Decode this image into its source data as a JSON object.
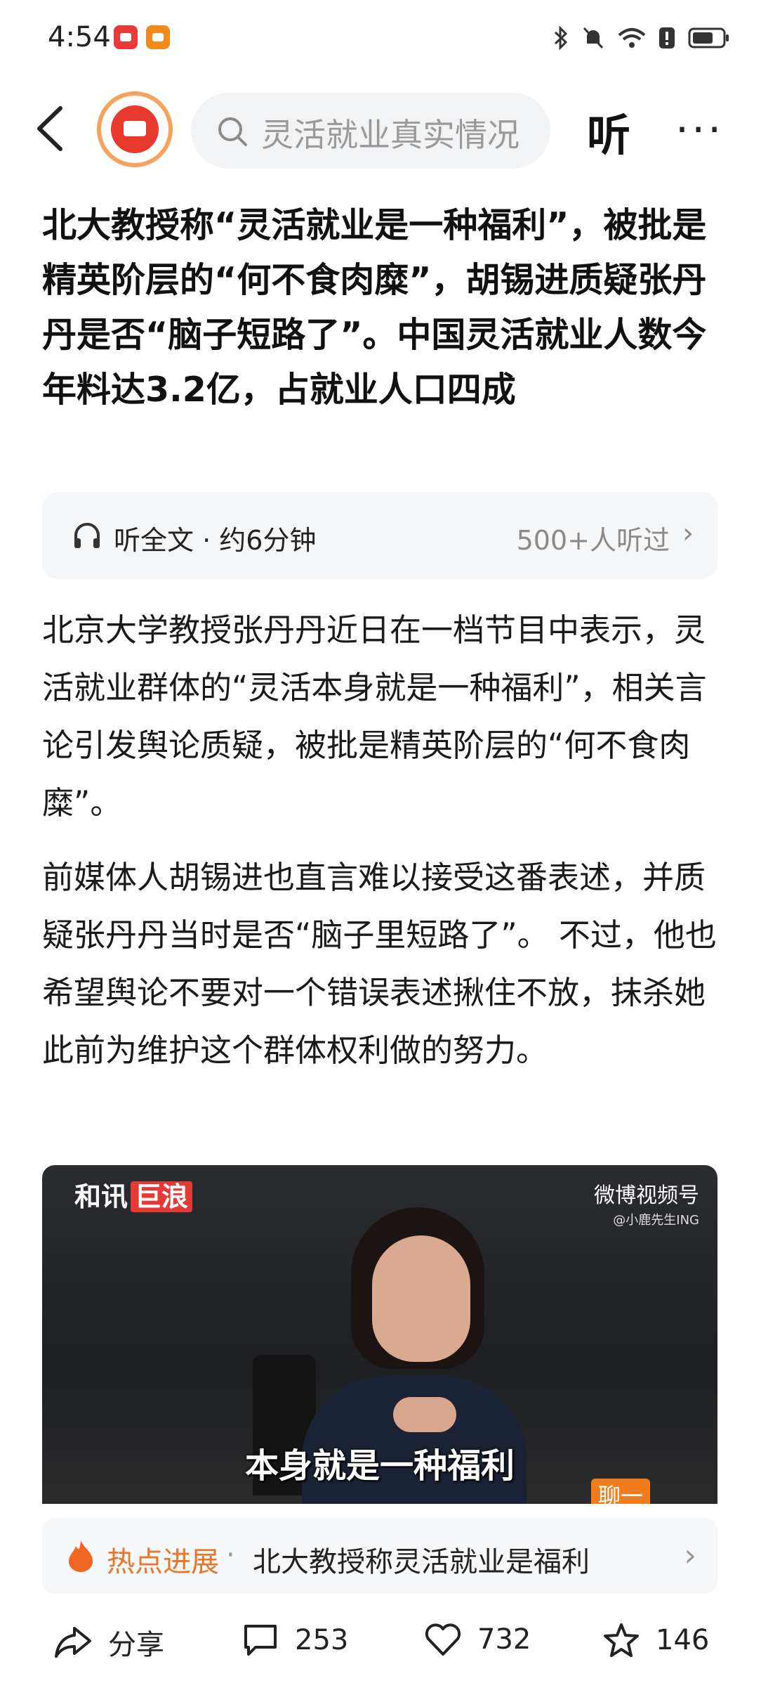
{
  "status_bar": {
    "time": "4:54"
  },
  "topbar": {
    "search_placeholder": "灵活就业真实情况",
    "listen_label": "听",
    "more_label": "···"
  },
  "article": {
    "title": "北大教授称“灵活就业是一种福利”，被批是精英阶层的“何不食肉糜”，胡锡进质疑张丹丹是否“脑子短路了”。中国灵活就业人数今年料达3.2亿，占就业人口四成",
    "audio": {
      "label": "听全文 · 约6分钟",
      "count": "500+人听过"
    },
    "paragraphs": [
      "北京大学教授张丹丹近日在一档节目中表示，灵活就业群体的“灵活本身就是一种福利”，相关言论引发舆论质疑，被批是精英阶层的“何不食肉糜”。",
      "前媒体人胡锡进也直言难以接受这番表述，并质疑张丹丹当时是否“脑子里短路了”。 不过，他也希望舆论不要对一个错误表述揪住不放，抹杀她此前为维护这个群体权利做的努力。"
    ],
    "video": {
      "logo_left": "和讯",
      "logo_left_tag": "巨浪",
      "logo_right": "微博视频号",
      "logo_right_sub": "@小鹿先生ING",
      "caption": "本身就是一种福利",
      "corner": "聊一"
    },
    "hot": {
      "label": "热点进展",
      "text": "北大教授称灵活就业是福利"
    }
  },
  "actions": {
    "share": "分享",
    "comments": "253",
    "likes": "732",
    "favorites": "146"
  },
  "colors": {
    "accent_orange": "#e8762a",
    "search_bg": "#f2f3f5"
  }
}
